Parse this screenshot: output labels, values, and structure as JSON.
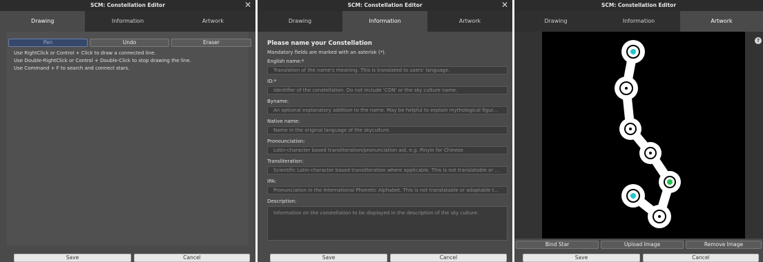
{
  "window_title": "SCM: Constellation Editor",
  "close_glyph": "✕",
  "tabs": {
    "drawing": "Drawing",
    "information": "Information",
    "artwork": "Artwork"
  },
  "drawing": {
    "tools": {
      "pen": "Pen",
      "undo": "Undo",
      "eraser": "Eraser"
    },
    "active_tool": "Pen",
    "hints": [
      "Use RightClick or Control + Click to draw a connected line.",
      "Use Double-RightClick or Control + Double-Click to stop drawing the line.",
      "Use Command + F to search and connect stars."
    ]
  },
  "information": {
    "heading": "Please name your Constellation",
    "mandatory_note": "Mandatory fields are marked with an asterisk (*).",
    "fields": [
      {
        "label": "English name:*",
        "placeholder": "Translation of the name's meaning. This is translated to users' language."
      },
      {
        "label": "ID:*",
        "placeholder": "Identifier of the constellation. Do not include 'CON' or the sky culture name."
      },
      {
        "label": "Byname:",
        "placeholder": "An optional explanatory addition to the name. May be helpful to explain mythological figur..."
      },
      {
        "label": "Native name:",
        "placeholder": "Name in the original language of the skyculture."
      },
      {
        "label": "Pronounciation:",
        "placeholder": "Latin-character based transliteration/pronunciation aid, e.g. Pinyin for Chinese."
      },
      {
        "label": "Transliteration:",
        "placeholder": "Scientific Latin-character based transliteration where applicable. This is not translatable or ..."
      },
      {
        "label": "IPA:",
        "placeholder": "Pronunciation in the International Phonetic Alphabet. This is not translatable or adaptable t..."
      },
      {
        "label": "Description:",
        "placeholder": "Information on the constellation to be displayed in the description of the sky culture."
      }
    ]
  },
  "artwork": {
    "help_glyph": "?",
    "buttons": {
      "bind_star": "Bind Star",
      "upload_image": "Upload Image",
      "remove_image": "Remove Image"
    },
    "star_colors": {
      "cyan": "#22c8d0",
      "green": "#22c24a"
    }
  },
  "footer": {
    "save": "Save",
    "cancel": "Cancel"
  },
  "colors": {
    "titlebar": "#2c2c2c",
    "panel": "#4a4a4a",
    "active_tool": "#35486c"
  }
}
